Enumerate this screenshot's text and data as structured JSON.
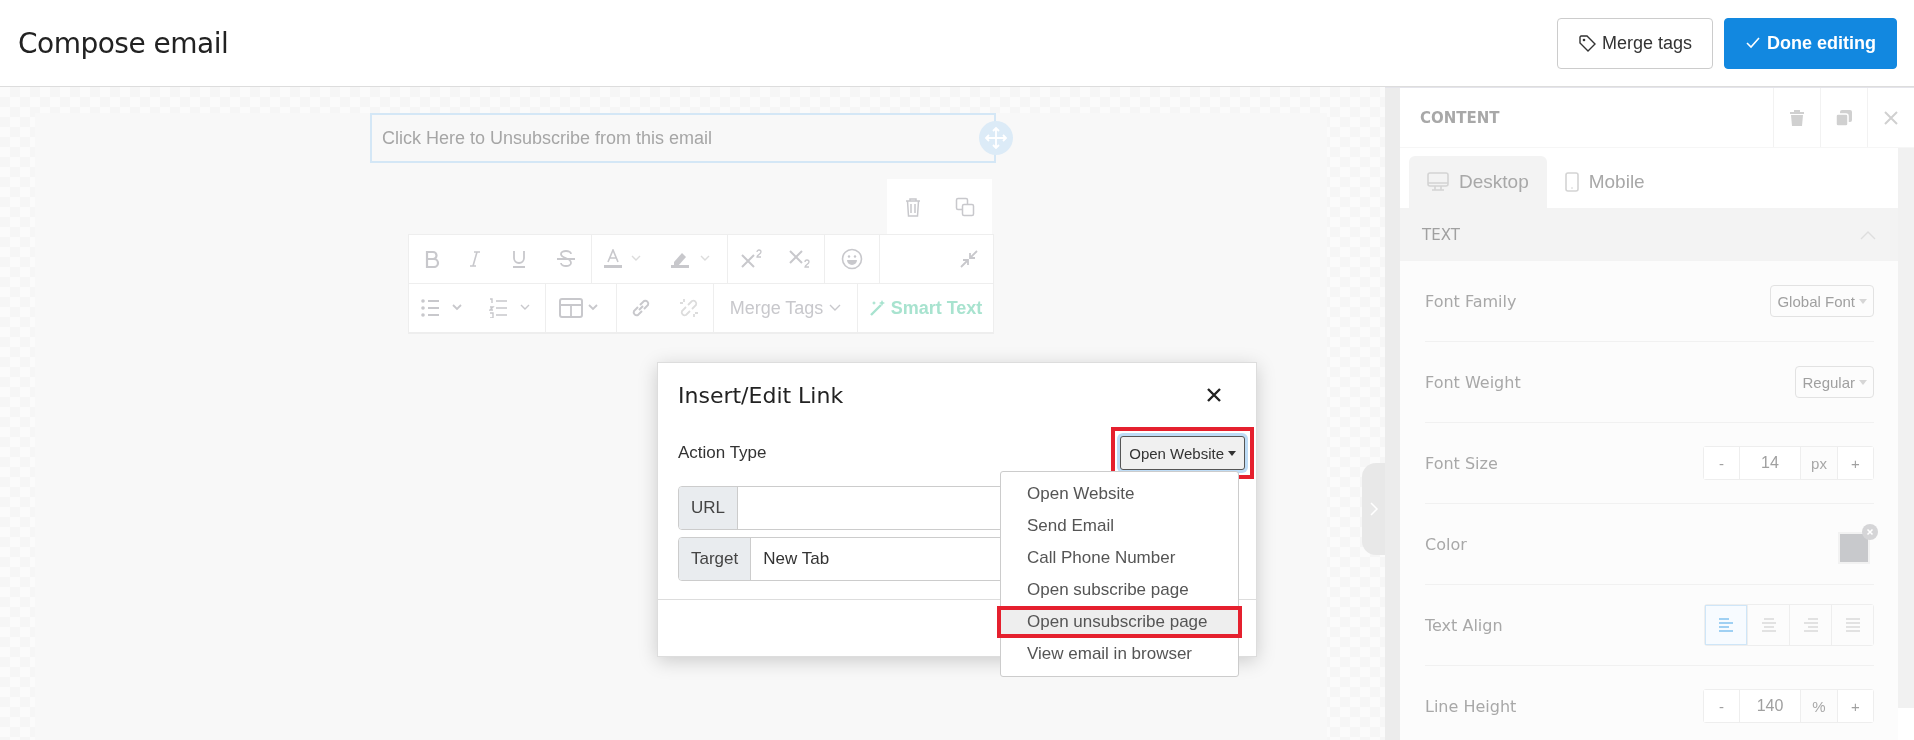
{
  "header": {
    "title": "Compose email",
    "buttons": [
      {
        "label": "Merge tags",
        "kind": "secondary"
      },
      {
        "label": "Done editing",
        "kind": "primary"
      }
    ]
  },
  "canvas": {
    "text_block": "Click Here to Unsubscribe from this email",
    "merge_tags": "Merge Tags",
    "smart_text": "Smart Text"
  },
  "link_dialog": {
    "title": "Insert/Edit Link",
    "action_type_label": "Action Type",
    "action_type_value": "Open Website",
    "action_type_annotated": true,
    "action_type_expanded": true,
    "fields": [
      {
        "label": "URL"
      },
      {
        "label": "Target",
        "value": "New Tab"
      }
    ],
    "options": [
      {
        "label": "Open Website",
        "selected": false,
        "annotated": false
      },
      {
        "label": "Send Email",
        "selected": false,
        "annotated": false
      },
      {
        "label": "Call Phone Number",
        "selected": false,
        "annotated": false
      },
      {
        "label": "Open subscribe page",
        "selected": false,
        "annotated": false
      },
      {
        "label": "Open unsubscribe page",
        "selected": true,
        "annotated": true
      },
      {
        "label": "View email in browser",
        "selected": false,
        "annotated": false
      }
    ]
  },
  "panel": {
    "title": "CONTENT",
    "tabs": [
      {
        "label": "Desktop",
        "selected": true
      },
      {
        "label": "Mobile",
        "selected": false
      }
    ],
    "section": {
      "title": "TEXT",
      "expanded": true
    },
    "properties": [
      {
        "label": "Font Family",
        "kind": "select",
        "value": "Global Font"
      },
      {
        "label": "Font Weight",
        "kind": "select",
        "value": "Regular"
      },
      {
        "label": "Font Size",
        "kind": "stepper",
        "value": "14",
        "unit": "px",
        "decrement": "-",
        "increment": "+"
      },
      {
        "label": "Color",
        "kind": "color"
      },
      {
        "label": "Text Align",
        "kind": "align",
        "options": [
          {
            "selected": true
          },
          {
            "selected": false
          },
          {
            "selected": false
          },
          {
            "selected": false
          }
        ]
      },
      {
        "label": "Line Height",
        "kind": "stepper",
        "value": "140",
        "unit": "%",
        "decrement": "-",
        "increment": "+"
      }
    ]
  }
}
